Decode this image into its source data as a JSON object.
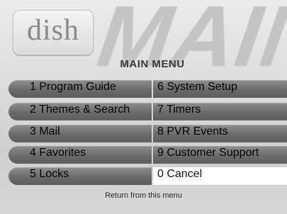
{
  "logo": {
    "text": "dish"
  },
  "background_word": "MAIN",
  "menu": {
    "title": "MAIN MENU",
    "left_items": [
      {
        "label": "1 Program Guide"
      },
      {
        "label": "2 Themes & Search"
      },
      {
        "label": "3 Mail"
      },
      {
        "label": "4 Favorites"
      },
      {
        "label": "5 Locks"
      }
    ],
    "right_items": [
      {
        "label": "6 System Setup"
      },
      {
        "label": "7 Timers"
      },
      {
        "label": "8 PVR Events"
      },
      {
        "label": "9 Customer Support"
      },
      {
        "label": "0  Cancel",
        "selected": true
      }
    ]
  },
  "footer": {
    "hint": "Return from this menu"
  },
  "colors": {
    "item_bg": "#6a6a6a",
    "selected_bg": "#ffffff",
    "item_text": "#ffffff",
    "selected_text": "#111111"
  }
}
